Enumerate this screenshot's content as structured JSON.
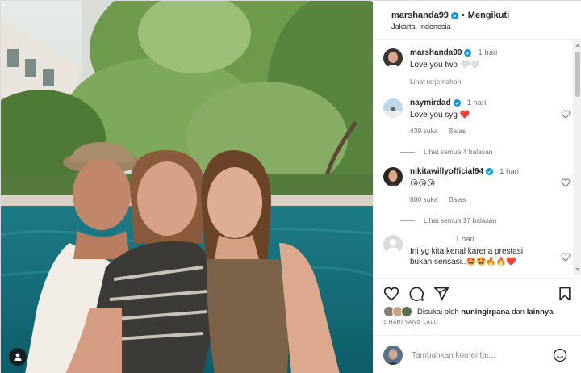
{
  "header": {
    "username": "marshanda99",
    "separator": "•",
    "follow_status": "Mengikuti",
    "location": "Jakarta, Indonesia"
  },
  "caption": {
    "username": "marshanda99",
    "time": "1 hari",
    "text": "Love you two 🤍🤍",
    "translate": "Lihat terjemahan"
  },
  "comments": [
    {
      "username": "naymirdad",
      "verified": true,
      "time": "1 hari",
      "text": "Love you syg ❤️",
      "likes": "439 suka",
      "reply": "Balas",
      "view_replies": "Lihat semua 4 balasan"
    },
    {
      "username": "nikitawillyofficial94",
      "verified": true,
      "time": "1 hari",
      "text": "😘😘😘",
      "likes": "880 suka",
      "reply": "Balas",
      "view_replies": "Lihat semua 17 balasan"
    },
    {
      "username": "",
      "verified": false,
      "time": "1 hari",
      "text": "Ini yg kita kenal karena prestasi bukan sensasi..🤩🤩🔥🔥❤️",
      "likes": "",
      "reply": "",
      "view_replies": ""
    }
  ],
  "actions": {
    "icons": [
      "heart-icon",
      "comment-icon",
      "share-icon",
      "bookmark-icon"
    ]
  },
  "likes": {
    "prefix": "Disukai oleh ",
    "user": "nuningirpana",
    "middle": " dan ",
    "others": "lainnya"
  },
  "post_date": "1 HARI YANG LALU",
  "add_comment": {
    "placeholder": "Tambahkan komentar..."
  },
  "colors": {
    "verified": "#0095f6",
    "heart_red": "#ed4956",
    "text": "#262626",
    "muted": "#737373",
    "border": "#efefef"
  }
}
